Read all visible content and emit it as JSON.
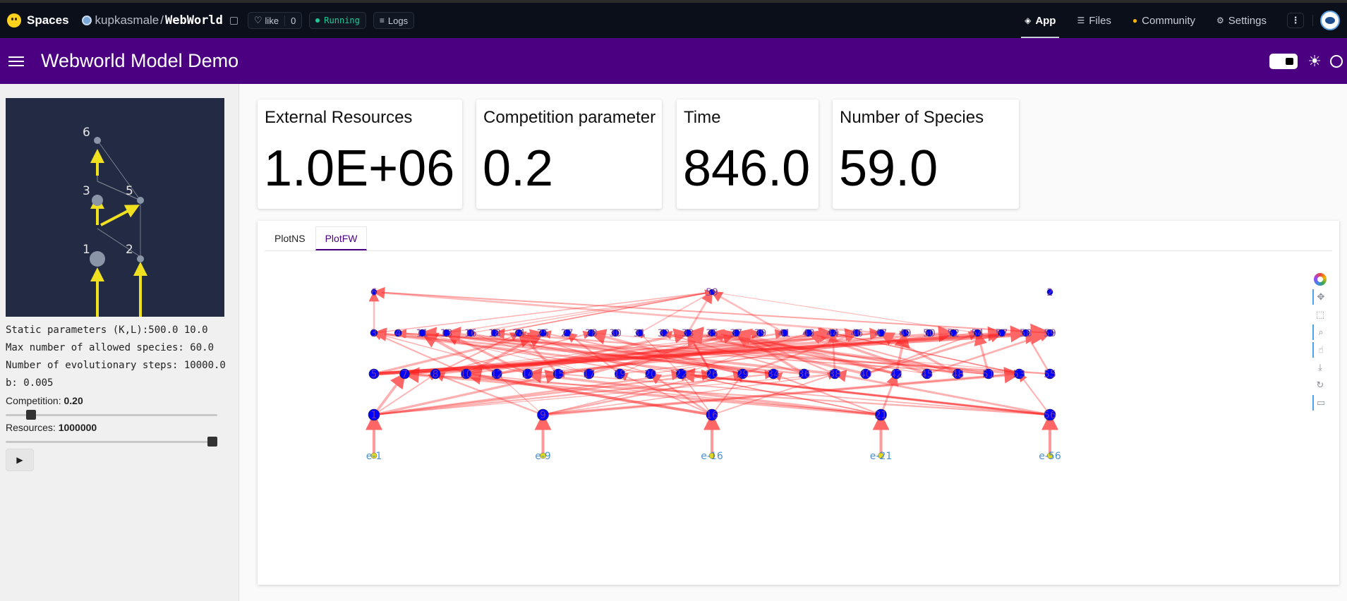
{
  "topbar": {
    "spaces_label": "Spaces",
    "repo_owner": "kupkasmale",
    "repo_sep": "/",
    "repo_name": "WebWorld",
    "like_label": "like",
    "like_count": "0",
    "status": "Running",
    "logs_label": "Logs",
    "nav": [
      {
        "label": "App",
        "icon": "cube-icon"
      },
      {
        "label": "Files",
        "icon": "files-icon"
      },
      {
        "label": "Community",
        "icon": "community-icon"
      },
      {
        "label": "Settings",
        "icon": "gear-icon"
      }
    ]
  },
  "appbar": {
    "title": "Webworld Model Demo"
  },
  "sidebar": {
    "thumb_graph": {
      "nodes": [
        {
          "id": "6",
          "size": "small"
        },
        {
          "id": "3",
          "size": "medium"
        },
        {
          "id": "5",
          "size": "small"
        },
        {
          "id": "1",
          "size": "large"
        },
        {
          "id": "2",
          "size": "small"
        }
      ]
    },
    "static_params": "Static parameters (K,L):500.0 10.0",
    "max_species": "Max number of allowed species: 60.0",
    "evo_steps": "Number of evolutionary steps: 10000.0",
    "b_param": "b: 0.005",
    "competition_label": "Competition:",
    "competition_value": "0.20",
    "competition_fraction": 0.2,
    "resources_label": "Resources:",
    "resources_value": "1000000",
    "resources_fraction": 1.0,
    "play_icon": "▶"
  },
  "cards": [
    {
      "title": "External Resources",
      "value": "1.0E+06"
    },
    {
      "title": "Competition parameter",
      "value": "0.2"
    },
    {
      "title": "Time",
      "value": "846.0"
    },
    {
      "title": "Number of Species",
      "value": "59.0"
    }
  ],
  "tabs": [
    "PlotNS",
    "PlotFW"
  ],
  "active_tab": "PlotFW",
  "toolbar_tools": [
    "bokeh-logo",
    "pan-icon",
    "box-zoom-icon",
    "wheel-zoom-icon",
    "tap-icon",
    "save-icon",
    "reset-icon",
    "hover-icon"
  ],
  "chart_data": {
    "type": "network",
    "levels": [
      {
        "level": 0,
        "labels": [
          "e-1",
          "e-9",
          "e-16",
          "e-21",
          "e-56"
        ]
      },
      {
        "level": 1,
        "labels": [
          "1",
          "9",
          "16",
          "21",
          "56"
        ]
      },
      {
        "level": 2,
        "labels": [
          "5",
          "7",
          "8",
          "10",
          "12",
          "14",
          "15",
          "17",
          "19",
          "20",
          "22",
          "26",
          "29",
          "34",
          "36",
          "38",
          "40",
          "42",
          "45",
          "48",
          "51",
          "53",
          "55"
        ]
      },
      {
        "level": 3,
        "labels": [
          "3",
          "4",
          "11",
          "13",
          "16",
          "18",
          "24",
          "25",
          "27",
          "28",
          "30",
          "31",
          "32",
          "33",
          "35",
          "37",
          "39",
          "41",
          "43",
          "44",
          "46",
          "47",
          "49",
          "50",
          "52",
          "54",
          "57",
          "58",
          "59"
        ]
      },
      {
        "level": 4,
        "labels": [
          "6",
          "59",
          "2"
        ]
      }
    ],
    "node_color": "#0000ff",
    "edge_color": "#ff2020",
    "resource_color": "#e3d820"
  }
}
